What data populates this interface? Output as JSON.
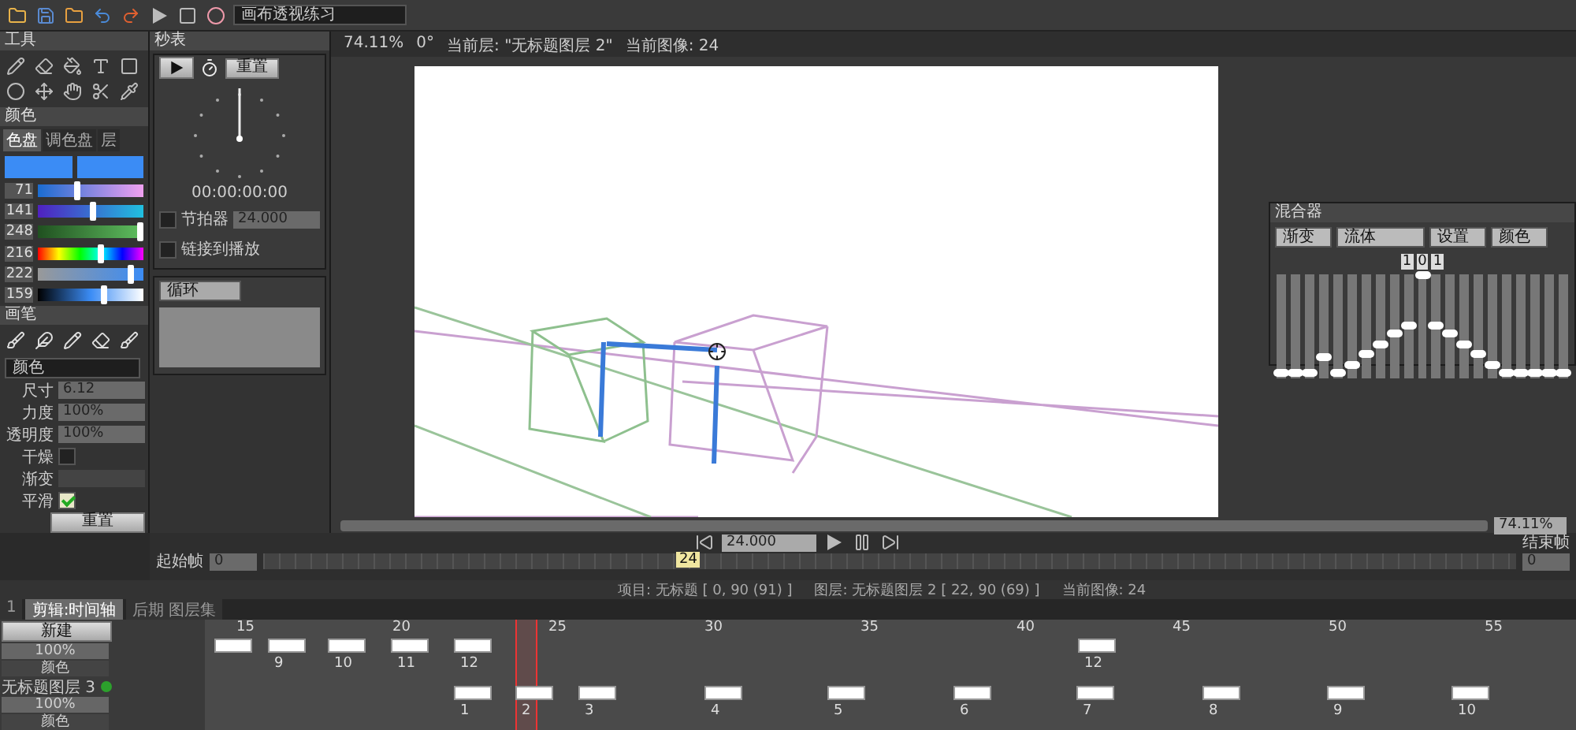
{
  "toolbar": {
    "preset": "画布透视练习"
  },
  "tools": {
    "title": "工具"
  },
  "color_panel": {
    "title": "颜色",
    "tabs": [
      {
        "label": "色盘",
        "selected": true
      },
      {
        "label": "调色盘",
        "selected": false
      },
      {
        "label": "层",
        "selected": false
      }
    ],
    "sliders": [
      {
        "reading": "71",
        "level": 0.38
      },
      {
        "reading": "141",
        "level": 0.52
      },
      {
        "reading": "248",
        "level": 0.97
      },
      {
        "reading": "216",
        "level": 0.6
      },
      {
        "reading": "222",
        "level": 0.88
      },
      {
        "reading": "159",
        "level": 0.62
      }
    ]
  },
  "brush_panel": {
    "title": "画笔",
    "mode": "颜色",
    "props": [
      {
        "kind": "field",
        "label": "尺寸",
        "value": "6.12"
      },
      {
        "kind": "field",
        "label": "力度",
        "value": "100%"
      },
      {
        "kind": "field",
        "label": "透明度",
        "value": "100%"
      },
      {
        "kind": "check",
        "label": "干燥",
        "checked": false
      },
      {
        "kind": "bar",
        "label": "渐变"
      },
      {
        "kind": "check",
        "label": "平滑",
        "checked": true
      }
    ],
    "reset": "重置"
  },
  "stopwatch": {
    "title": "秒表",
    "reset": "重置",
    "time": "00:00:00:00",
    "metronome": {
      "label": "节拍器",
      "value": "24.000",
      "checked": false
    },
    "link": {
      "label": "链接到播放",
      "checked": false
    },
    "loop": "循环"
  },
  "view": {
    "zoom": "74.11%",
    "angle": "0°",
    "layer": "当前层: \"无标题图层 2\"",
    "frame": "当前图像: 24"
  },
  "mixer": {
    "title": "混合器",
    "selects": [
      "渐变",
      "流体",
      "设置",
      "颜色"
    ],
    "digits": [
      "1",
      "0",
      "1"
    ],
    "faders": [
      {
        "level": 0.05
      },
      {
        "level": 0.05
      },
      {
        "level": 0.05
      },
      {
        "level": 0.2
      },
      {
        "level": 0.05
      },
      {
        "level": 0.12
      },
      {
        "level": 0.22
      },
      {
        "level": 0.32
      },
      {
        "level": 0.42
      },
      {
        "level": 0.5
      },
      {
        "level": 0.98
      },
      {
        "level": 0.5
      },
      {
        "level": 0.42
      },
      {
        "level": 0.32
      },
      {
        "level": 0.22
      },
      {
        "level": 0.12
      },
      {
        "level": 0.05
      },
      {
        "level": 0.05
      },
      {
        "level": 0.05
      },
      {
        "level": 0.05
      },
      {
        "level": 0.05
      }
    ]
  },
  "playback": {
    "zoom": "74.11%",
    "fps": "24.000",
    "start_label": "起始帧",
    "start": "0",
    "marker": "24",
    "end_label": "结束帧",
    "end": "0"
  },
  "status": [
    "项目: 无标题 [ 0, 90 (91) ]",
    "图层: 无标题图层 2 [ 22, 90 (69) ]",
    "当前图像: 24"
  ],
  "bottom_tabs": [
    {
      "label": "1",
      "selected": false
    },
    {
      "label": "剪辑:时间轴",
      "selected": true
    },
    {
      "label": "后期 图层集",
      "selected": false
    }
  ],
  "timeline": {
    "new": "新建",
    "ruler": [
      "15",
      "20",
      "25",
      "30",
      "35",
      "40",
      "45",
      "50",
      "55"
    ],
    "layers": [
      {
        "opacity": "100%",
        "blend": "颜色",
        "leading_frame": true,
        "frames": [
          {
            "label": "9"
          },
          {
            "label": "10"
          },
          {
            "label": "11"
          },
          {
            "label": "12"
          },
          {
            "label": "12"
          }
        ]
      },
      {
        "name": "无标题图层 3",
        "visible": true,
        "opacity": "100%",
        "blend": "颜色",
        "frames": [
          {
            "label": "1"
          },
          {
            "label": "2"
          },
          {
            "label": "3"
          },
          {
            "label": "4"
          },
          {
            "label": "5"
          },
          {
            "label": "6"
          },
          {
            "label": "7"
          },
          {
            "label": "8"
          },
          {
            "label": "9"
          },
          {
            "label": "10"
          }
        ]
      }
    ]
  }
}
